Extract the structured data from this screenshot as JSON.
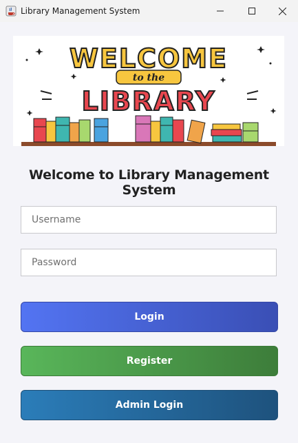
{
  "window": {
    "title": "Library Management System",
    "icon": "java-cup-icon"
  },
  "banner": {
    "line1": "WELCOME",
    "line2": "to the",
    "line3": "LIBRARY"
  },
  "heading": "Welcome to Library Management System",
  "form": {
    "username_placeholder": "Username",
    "password_placeholder": "Password",
    "username_value": "",
    "password_value": ""
  },
  "buttons": {
    "login": "Login",
    "register": "Register",
    "admin_login": "Admin Login"
  },
  "colors": {
    "login": "#4a66de",
    "register": "#4c9a4b",
    "admin": "#25699b",
    "banner_red": "#e8474f",
    "banner_yellow": "#f7c63f",
    "banner_teal": "#3fb6b0"
  }
}
